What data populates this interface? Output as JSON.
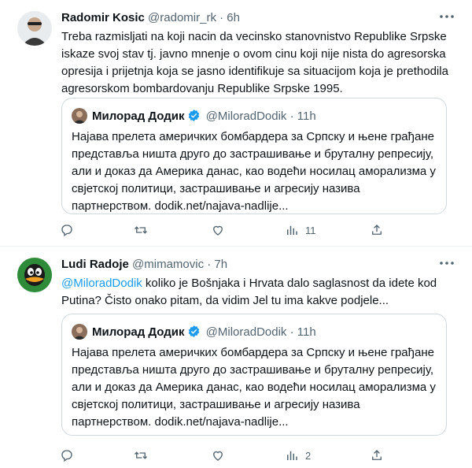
{
  "tweets": [
    {
      "name": "Radomir Kosic",
      "handle": "@radomir_rk",
      "dot": "·",
      "time": "6h",
      "text": "Treba razmisljati na koji nacin da vecinsko stanovnistvo Republike Srpske iskaze svoj stav tj. javno mnenje o ovom cinu koji nije nista do agresorska opresija i prijetnja koja se jasno identifikuje sa situacijom koja je prethodila agresorskom bombardovanju Republike Srpske 1995.",
      "quote": {
        "name": "Милорад Додик",
        "handle": "@MiloradDodik",
        "dot": "·",
        "time": "11h",
        "text": "Најава прелета америчких бомбардера за Српску и њене грађане представља ништа друго до застрашивање и бруталну репресију, али и доказ да Америка данас, као водећи носилац аморализма у свјетској политици, застрашивање и агресију назива партнерством. dodik.net/najava-nadlije..."
      },
      "views": "11",
      "retweets": "",
      "likes": "",
      "replies": ""
    },
    {
      "name": "Ludi Radoje",
      "handle": "@mimamovic",
      "dot": "·",
      "time": "7h",
      "mention": "@MiloradDodik",
      "text": " koliko je Bošnjaka i Hrvata dalo saglasnost da idete kod Putina? Čisto onako pitam, da vidim Jel tu ima kakve podjele...",
      "quote": {
        "name": "Милорад Додик",
        "handle": "@MiloradDodik",
        "dot": "·",
        "time": "11h",
        "text": "Најава прелета америчких бомбардера за Српску и њене грађане представља ништа друго до застрашивање и бруталну репресију, али и доказ да Америка данас, као водећи носилац аморализма у свјетској политици, застрашивање и агресију назива партнерством. dodik.net/najava-nadlije..."
      },
      "views": "2",
      "retweets": "",
      "likes": "",
      "replies": ""
    }
  ],
  "icons": {
    "reply": "reply-icon",
    "retweet": "retweet-icon",
    "like": "like-icon",
    "views": "views-icon",
    "share": "share-icon",
    "more": "more-icon",
    "verified": "verified-badge-icon"
  },
  "colors": {
    "link": "#1d9bf0",
    "secondary_text": "#536471",
    "verified": "#1d9bf0",
    "border": "#cfd9de"
  }
}
